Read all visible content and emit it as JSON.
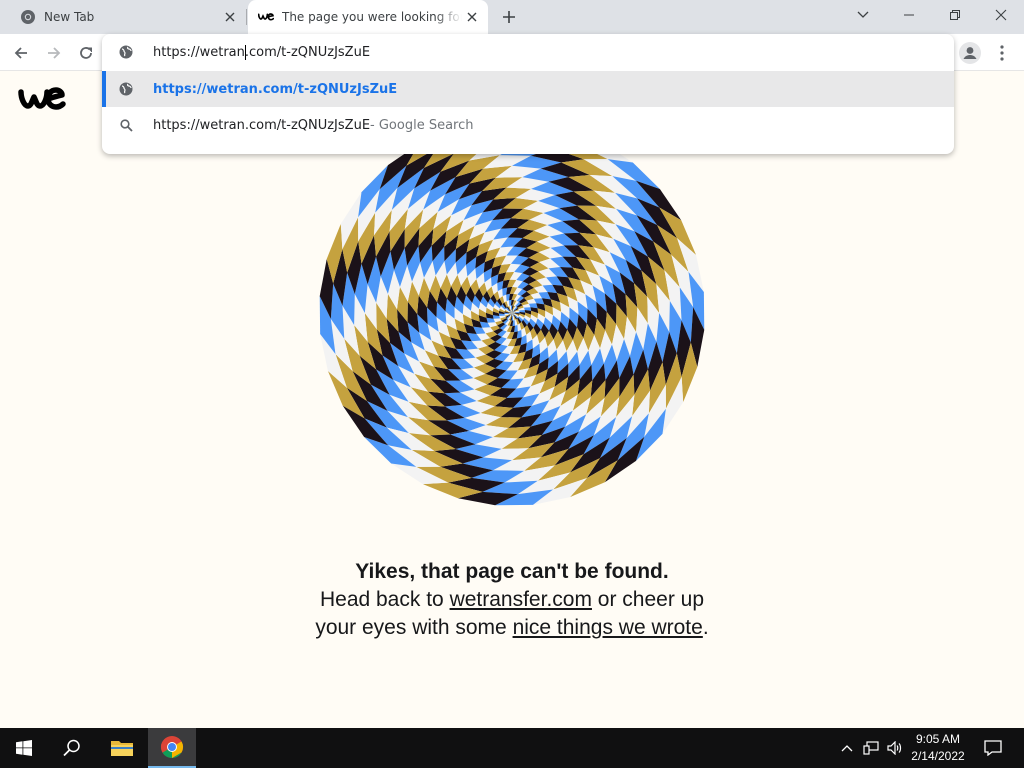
{
  "browser": {
    "tabs": [
      {
        "title": "New Tab",
        "icon": "chrome-icon"
      },
      {
        "title": "The page you were looking for doesn't exist",
        "icon": "wetransfer-icon",
        "active": true
      }
    ],
    "address_value_before_caret": "https://wetran",
    "address_value_after_caret": ".com/t-zQNUzJsZuE",
    "suggestions": [
      {
        "url": "https://wetran.com/t-zQNUzJsZuE",
        "icon": "globe-icon",
        "selected": true
      },
      {
        "url": "https://wetran.com/t-zQNUzJsZuE",
        "suffix": " - Google Search",
        "icon": "search-icon"
      }
    ]
  },
  "page": {
    "logo": "we",
    "error_title": "Yikes, that page can't be found.",
    "line_part1": "Head back to ",
    "link_home": "wetransfer.com",
    "line_part2": " or cheer up your eyes with some ",
    "link_things": "nice things we wrote",
    "line_end": "."
  },
  "taskbar": {
    "time": "9:05 AM",
    "date": "2/14/2022"
  },
  "colors": {
    "page_bg": "#fffcf5",
    "spiral_black": "#1b1219",
    "spiral_gold": "#c5a23f",
    "spiral_white": "#f3f3f3",
    "spiral_blue": "#4d97f7",
    "link_blue": "#1a73e8"
  }
}
